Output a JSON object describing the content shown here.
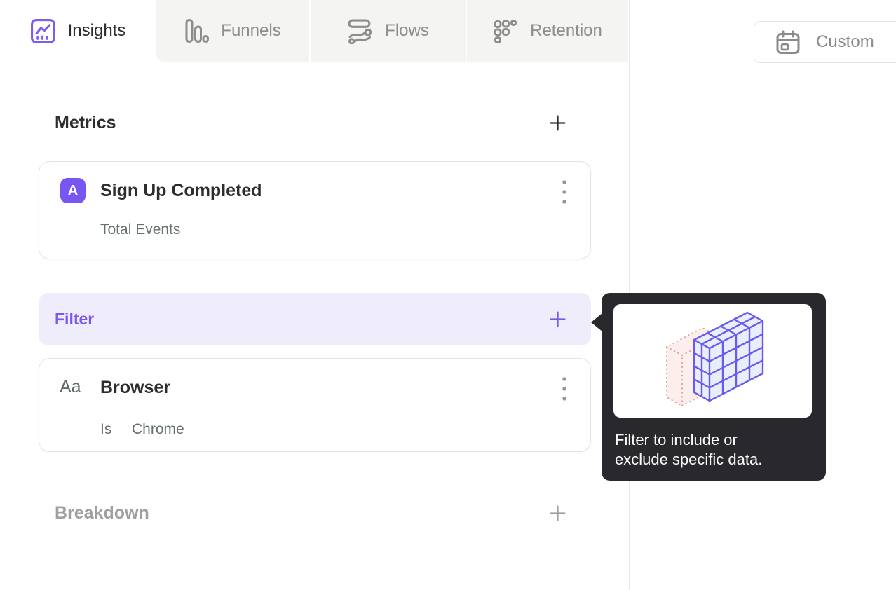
{
  "tabs": [
    {
      "label": "Insights",
      "active": true
    },
    {
      "label": "Funnels",
      "active": false
    },
    {
      "label": "Flows",
      "active": false
    },
    {
      "label": "Retention",
      "active": false
    }
  ],
  "toolbar": {
    "custom_label": "Custom"
  },
  "sections": {
    "metrics": {
      "title": "Metrics",
      "add_icon": "plus-icon"
    },
    "filter": {
      "title": "Filter",
      "add_icon": "plus-icon"
    },
    "breakdown": {
      "title": "Breakdown",
      "add_icon": "plus-icon"
    }
  },
  "metric_card": {
    "badge": "A",
    "title": "Sign Up Completed",
    "subtitle": "Total Events",
    "menu_icon": "kebab-menu-icon"
  },
  "filter_card": {
    "type_icon_label": "Aa",
    "title": "Browser",
    "operator": "Is",
    "value": "Chrome",
    "menu_icon": "kebab-menu-icon"
  },
  "tooltip": {
    "line1": "Filter to include or",
    "line2": "exclude specific data.",
    "illustration": "isometric-cube-filter-illustration"
  },
  "icons": {
    "insights": "line-chart-icon",
    "funnels": "bar-chart-icon",
    "flows": "flow-stream-icon",
    "retention": "dot-grid-icon",
    "custom": "calendar-icon"
  },
  "colors": {
    "accent_purple": "#7856f2",
    "filter_row_bg": "#efecfb",
    "tooltip_bg": "#29282d",
    "inactive_tab_bg": "#f4f4f2",
    "dark_text": "#2d2d30",
    "gray_text": "#8d8d8d",
    "subtle_text": "#66706e",
    "cube_purple": "#6a5af0",
    "cube_pink": "#e0a3a3"
  }
}
